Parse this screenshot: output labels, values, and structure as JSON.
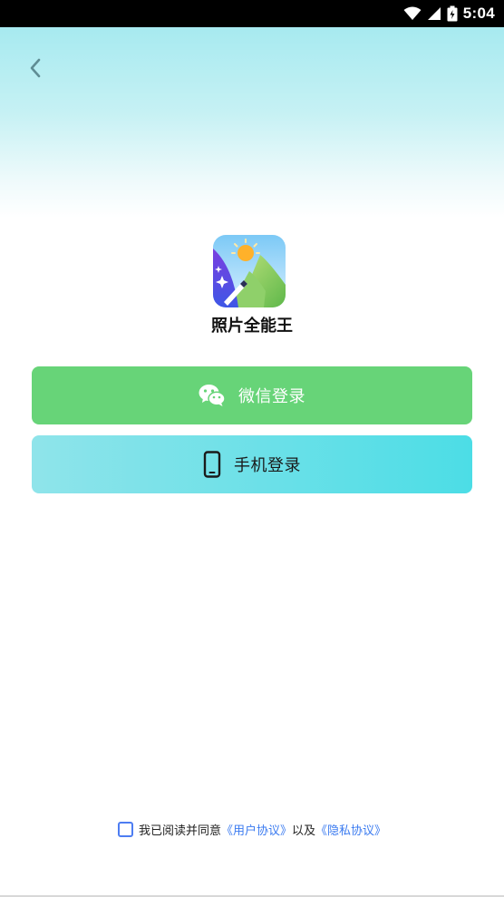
{
  "status_bar": {
    "time": "5:04",
    "icons": [
      "wifi-icon",
      "cell-signal-icon",
      "battery-icon"
    ]
  },
  "header": {
    "back_icon": "chevron-left-icon"
  },
  "app": {
    "name": "照片全能王",
    "logo_icon": "photo-landscape-icon"
  },
  "buttons": {
    "wechat_label": "微信登录",
    "wechat_icon": "wechat-icon",
    "phone_label": "手机登录",
    "phone_icon": "mobile-phone-icon"
  },
  "agreement": {
    "prefix": "我已阅读并同意",
    "user_agreement": "《用户协议》",
    "conjunction": "以及",
    "privacy_policy": "《隐私协议》",
    "checked": false
  },
  "colors": {
    "wechat_button": "#67d478",
    "phone_button_start": "#8fe4ea",
    "phone_button_end": "#4cdde6",
    "link": "#3b7bf0",
    "checkbox_border": "#4d7df2"
  }
}
